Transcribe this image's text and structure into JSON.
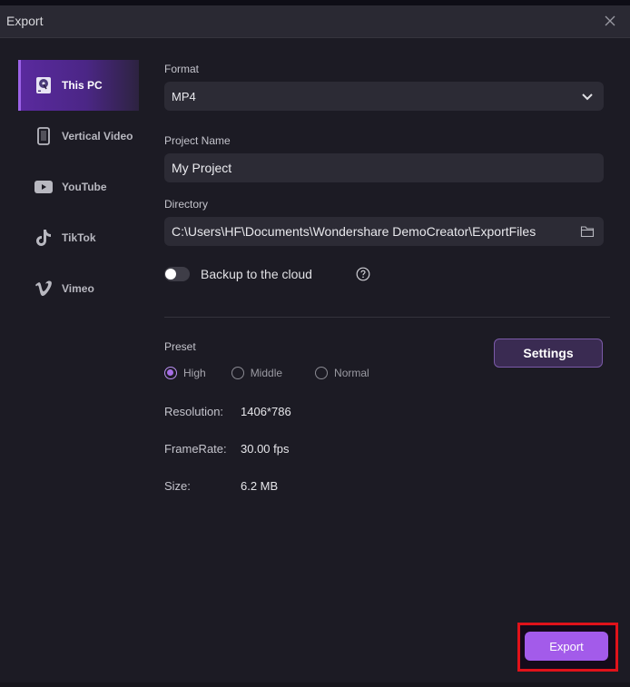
{
  "window": {
    "title": "Export",
    "close_icon": "close-x-icon"
  },
  "sidebar": {
    "items": [
      {
        "label": "This PC",
        "icon": "hard-drive-icon",
        "active": true
      },
      {
        "label": "Vertical Video",
        "icon": "phone-icon",
        "active": false
      },
      {
        "label": "YouTube",
        "icon": "youtube-icon",
        "active": false
      },
      {
        "label": "TikTok",
        "icon": "tiktok-icon",
        "active": false
      },
      {
        "label": "Vimeo",
        "icon": "vimeo-icon",
        "active": false
      }
    ]
  },
  "form": {
    "format_label": "Format",
    "format_value": "MP4",
    "project_name_label": "Project Name",
    "project_name_value": "My Project",
    "directory_label": "Directory",
    "directory_value": "C:\\Users\\HF\\Documents\\Wondershare DemoCreator\\ExportFiles",
    "backup_label": "Backup to the cloud",
    "backup_enabled": false
  },
  "preset": {
    "label": "Preset",
    "options": [
      {
        "label": "High",
        "checked": true
      },
      {
        "label": "Middle",
        "checked": false
      },
      {
        "label": "Normal",
        "checked": false
      }
    ],
    "settings_label": "Settings"
  },
  "info": {
    "resolution_label": "Resolution:",
    "resolution_value": "1406*786",
    "framerate_label": "FrameRate:",
    "framerate_value": "30.00 fps",
    "size_label": "Size:",
    "size_value": "6.2 MB"
  },
  "actions": {
    "export_label": "Export"
  },
  "colors": {
    "accent": "#a35bea",
    "highlight_box": "#e0121a",
    "background": "#1c1b24"
  }
}
